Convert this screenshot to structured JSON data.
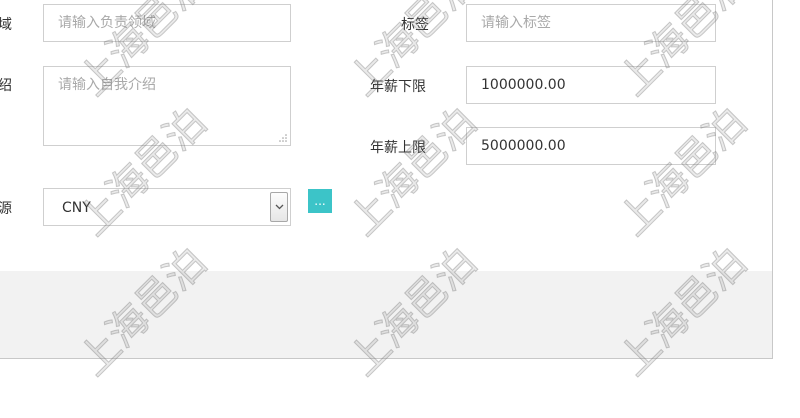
{
  "form": {
    "row1": {
      "left_label": "域",
      "left_placeholder": "请输入负责领域",
      "right_label": "标签",
      "right_placeholder": "请输入标签"
    },
    "row2": {
      "left_label": "绍",
      "left_placeholder": "请输入自我介绍",
      "right_label": "年薪下限",
      "right_value": "1000000.00"
    },
    "row3": {
      "right_label": "年薪上限",
      "right_value": "5000000.00"
    },
    "row4": {
      "left_label": "源",
      "select_value": "CNY",
      "more_label": "..."
    }
  },
  "watermark": "上海邑泊",
  "colors": {
    "accent": "#3cc4c8",
    "border": "#cfcfcf",
    "placeholder": "#a9a9a9",
    "footer": "#f2f2f2"
  },
  "icons": {
    "select_arrow": "chevron-down-icon",
    "resize": "resize-grip-icon"
  }
}
